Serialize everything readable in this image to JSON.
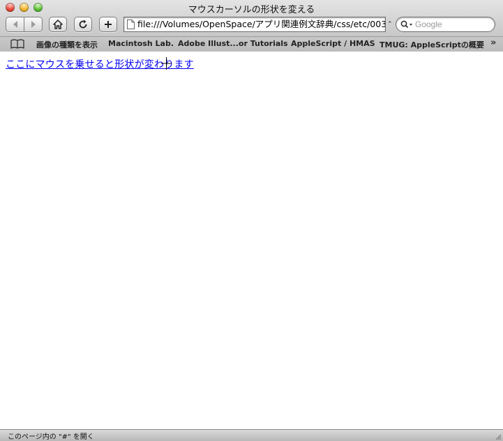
{
  "window": {
    "title": "マウスカーソルの形状を変える"
  },
  "toolbar": {
    "back_icon": "back-arrow-icon",
    "forward_icon": "forward-arrow-icon",
    "home_icon": "home-icon",
    "reload_icon": "reload-icon",
    "add_icon": "plus-icon",
    "address": "file:///Volumes/OpenSpace/アプリ関連例文辞典/css/etc/003",
    "search_placeholder": "Google"
  },
  "bookmarks": {
    "items": [
      {
        "label": "画像の種類を表示"
      },
      {
        "label": "Macintosh Lab."
      },
      {
        "label": "Adobe Illust...or Tutorials"
      },
      {
        "label": "AppleScript / HMAS"
      },
      {
        "label": "TMUG: AppleScriptの概要"
      }
    ],
    "more": "»"
  },
  "content": {
    "link_text": "ここにマウスを乗せると形状が変わります"
  },
  "status": {
    "text": "このページ内の \"#\" を開く"
  }
}
